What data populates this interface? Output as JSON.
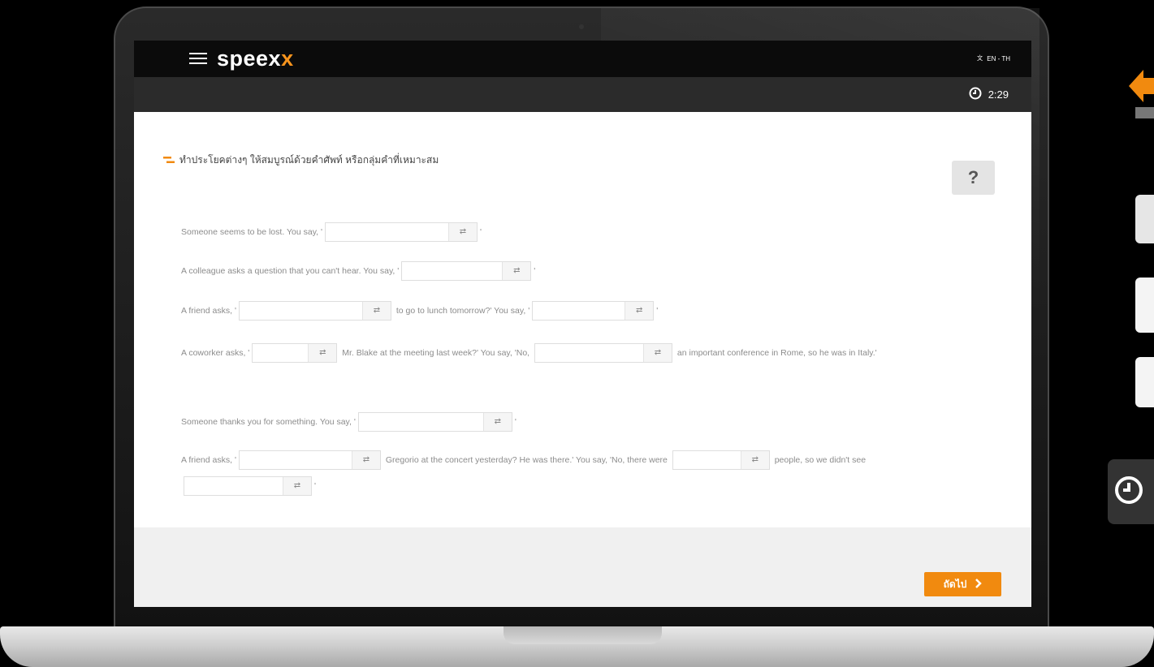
{
  "app": {
    "logo_prefix": "speex",
    "logo_suffix": "x",
    "language": "EN - TH",
    "timer": "2:29"
  },
  "exercise": {
    "instruction": "ทำประโยคต่างๆ ให้สมบูรณ์ด้วยคำศัพท์ หรือกลุ่มคำที่เหมาะสม",
    "help_label": "?",
    "sentences": [
      {
        "parts": [
          "Someone seems to be lost. You say, '",
          "'"
        ]
      },
      {
        "parts": [
          "A colleague asks a question that you can't hear. You say, '",
          "'"
        ]
      },
      {
        "parts": [
          "A friend asks, '",
          " to go to lunch tomorrow?' You say, '",
          "'"
        ]
      },
      {
        "parts": [
          "A coworker asks, '",
          " Mr. Blake at the meeting last week?' You say, 'No, ",
          " an important conference in Rome, so he was in Italy.'"
        ]
      },
      {
        "parts": [
          "Someone thanks you for something. You say, '",
          "'"
        ]
      },
      {
        "parts": [
          "A friend asks, '",
          " Gregorio at the concert yesterday? He was there.' You say, 'No, there were ",
          " people, so we didn't see ",
          "'"
        ]
      }
    ]
  },
  "footer": {
    "next_label": "ถัดไป"
  },
  "colors": {
    "accent": "#f18a0f",
    "topbar": "#0b0b0b",
    "subbar": "#2b2b2b"
  },
  "icons": [
    "menu-icon",
    "translate-icon",
    "clock-icon",
    "swap-icon",
    "help-icon",
    "chevron-right-icon"
  ]
}
